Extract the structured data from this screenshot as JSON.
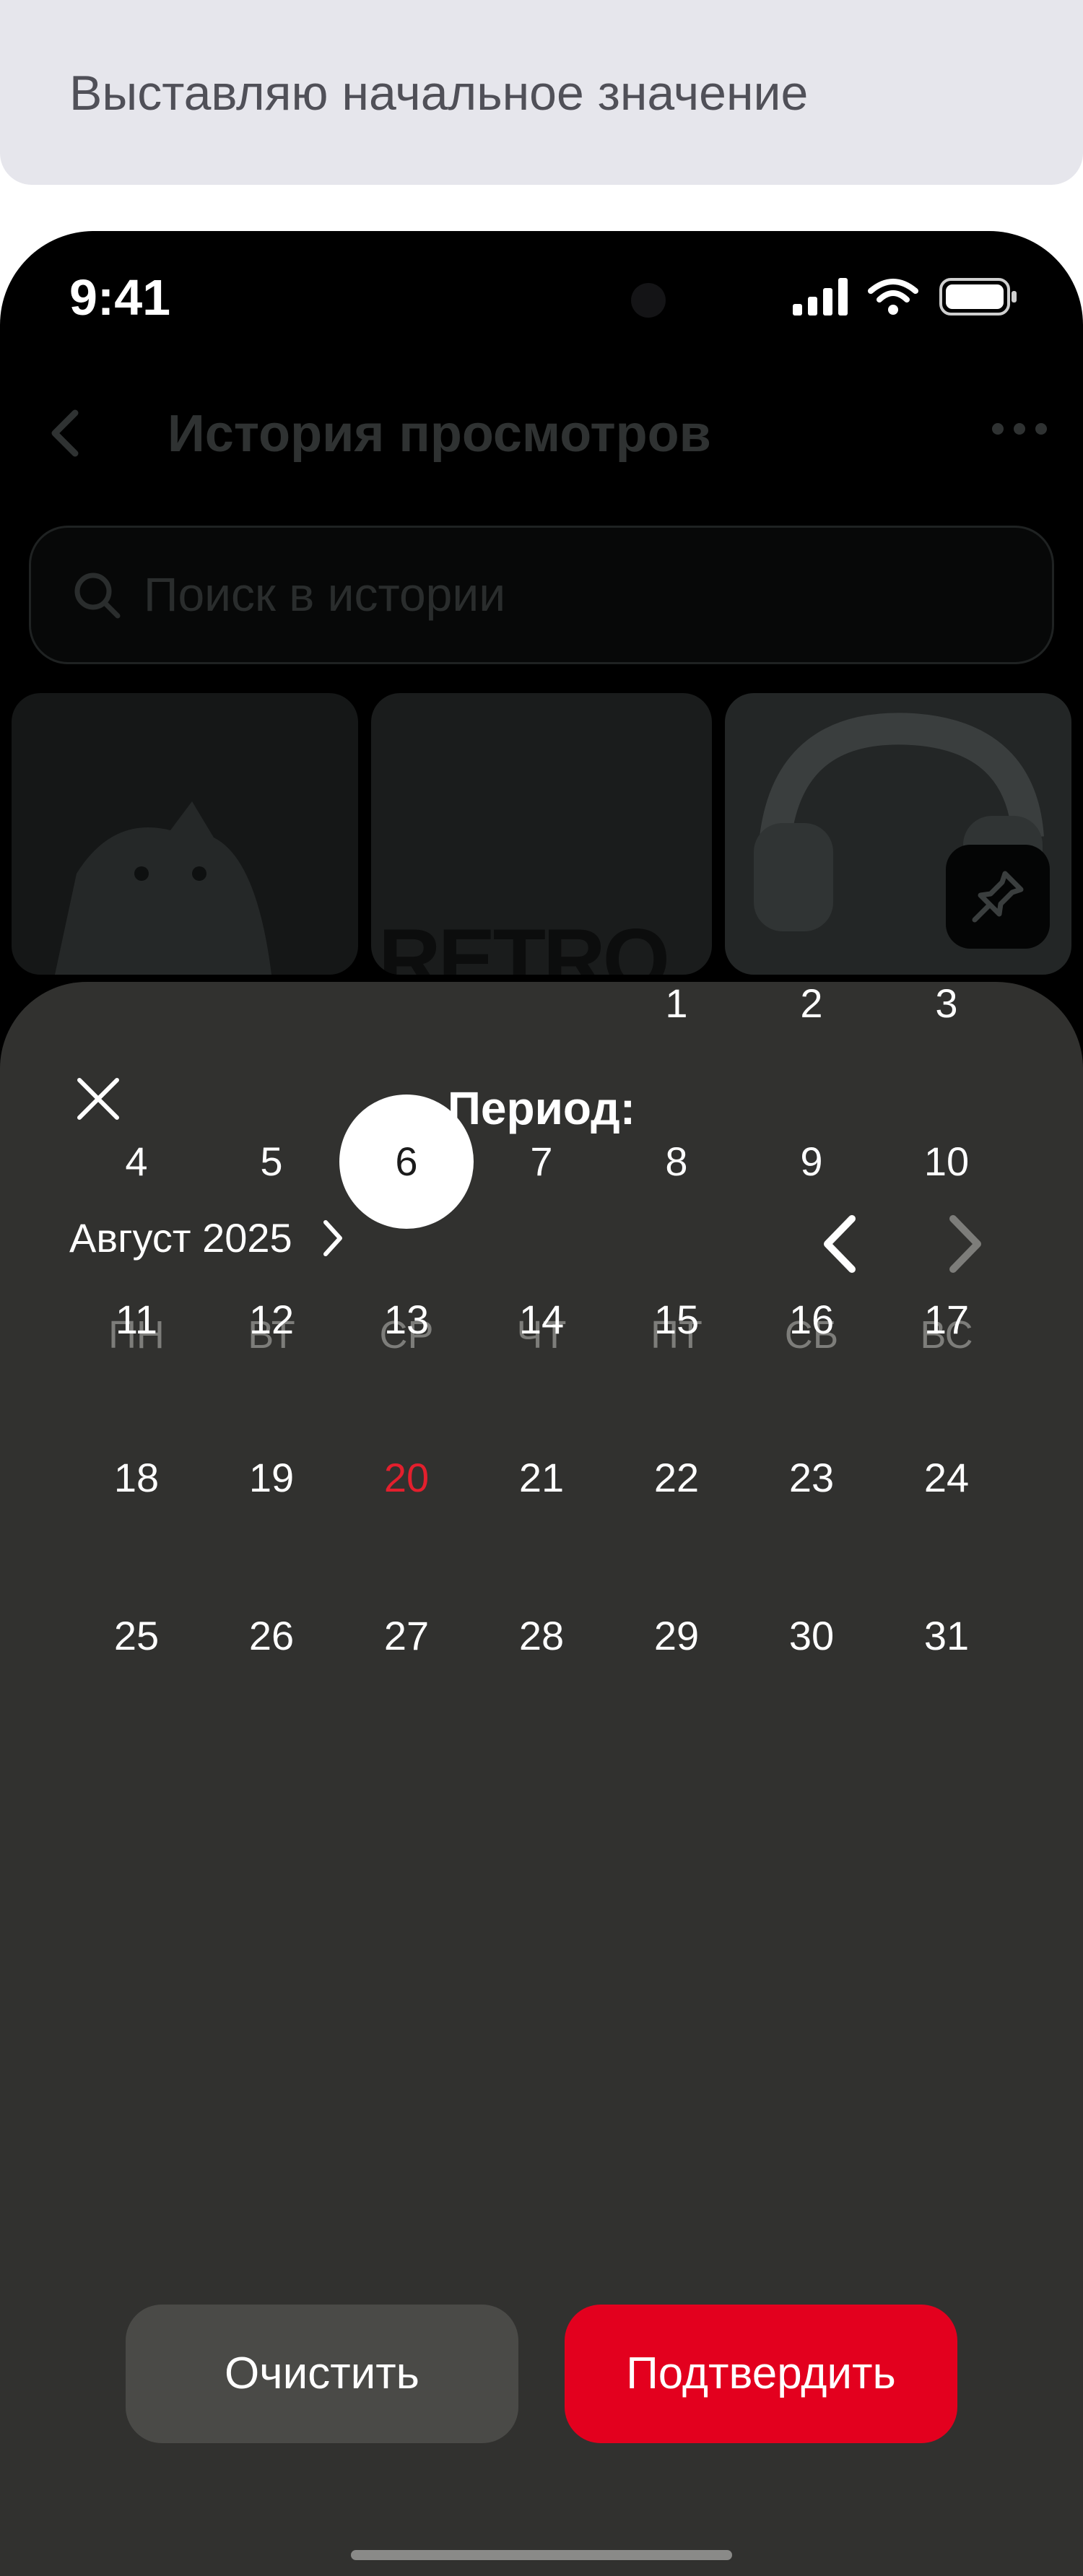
{
  "caption": "Выставляю начальное значение",
  "status_bar": {
    "time": "9:41"
  },
  "background_screen": {
    "title": "История просмотров",
    "search_placeholder": "Поиск в истории",
    "thumbnail_text": "RETRO"
  },
  "sheet": {
    "title": "Период:",
    "month_label": "Август 2025",
    "weekdays": [
      "ПН",
      "ВТ",
      "СР",
      "ЧТ",
      "ПТ",
      "СБ",
      "ВС"
    ],
    "days": [
      "1",
      "2",
      "3",
      "4",
      "5",
      "6",
      "7",
      "8",
      "9",
      "10",
      "11",
      "12",
      "13",
      "14",
      "15",
      "16",
      "17",
      "18",
      "19",
      "20",
      "21",
      "22",
      "23",
      "24",
      "25",
      "26",
      "27",
      "28",
      "29",
      "30",
      "31"
    ],
    "first_weekday_index": 4,
    "selected_day": "6",
    "today_day": "20",
    "clear_label": "Очистить",
    "confirm_label": "Подтвердить"
  },
  "colors": {
    "accent": "#e3001e",
    "today": "#e31f2d",
    "sheet_bg": "#31312f",
    "selected_bg": "#ffffff"
  }
}
